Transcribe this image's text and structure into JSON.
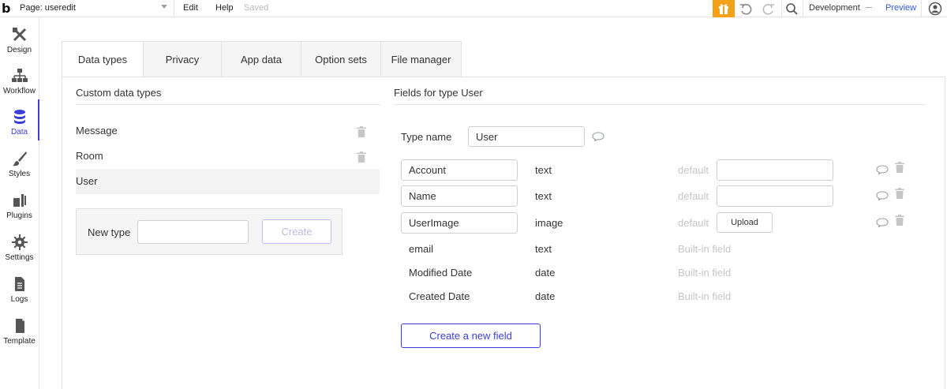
{
  "topbar": {
    "logo": "b",
    "page_label": "Page: useredit",
    "menu_edit": "Edit",
    "menu_help": "Help",
    "status": "Saved",
    "environment": "Development",
    "preview": "Preview",
    "icons": [
      "page-dropdown-icon",
      "gift-icon",
      "undo-icon",
      "redo-icon",
      "search-icon",
      "account-icon"
    ]
  },
  "sidebar": {
    "items": [
      {
        "label": "Design",
        "icon": "design-icon"
      },
      {
        "label": "Workflow",
        "icon": "workflow-icon"
      },
      {
        "label": "Data",
        "icon": "database-icon"
      },
      {
        "label": "Styles",
        "icon": "brush-icon"
      },
      {
        "label": "Plugins",
        "icon": "plugin-icon"
      },
      {
        "label": "Settings",
        "icon": "gear-icon"
      },
      {
        "label": "Logs",
        "icon": "logs-icon"
      },
      {
        "label": "Template",
        "icon": "template-icon"
      }
    ],
    "active": "Data"
  },
  "tabs": [
    {
      "label": "Data types"
    },
    {
      "label": "Privacy"
    },
    {
      "label": "App data"
    },
    {
      "label": "Option sets"
    },
    {
      "label": "File manager"
    }
  ],
  "custom_types": {
    "title": "Custom data types",
    "items": [
      {
        "name": "Message"
      },
      {
        "name": "Room"
      },
      {
        "name": "User"
      }
    ],
    "selected": "User",
    "new_type_label": "New type",
    "new_type_value": "",
    "create_button": "Create"
  },
  "fields": {
    "title": "Fields for type User",
    "type_name_label": "Type name",
    "type_name_value": "User",
    "custom": [
      {
        "name": "Account",
        "type": "text",
        "default_label": "default",
        "default_value": ""
      },
      {
        "name": "Name",
        "type": "text",
        "default_label": "default",
        "default_value": ""
      },
      {
        "name": "UserImage",
        "type": "image",
        "default_label": "default",
        "upload_label": "Upload"
      }
    ],
    "builtin": [
      {
        "name": "email",
        "type": "text",
        "note": "Built-in field"
      },
      {
        "name": "Modified Date",
        "type": "date",
        "note": "Built-in field"
      },
      {
        "name": "Created Date",
        "type": "date",
        "note": "Built-in field"
      }
    ],
    "new_field_button": "Create a new field"
  },
  "colors": {
    "accent": "#3b3fd8",
    "gift": "#f4a11a",
    "preview_link": "#2e5bd6",
    "muted_text": "#c5c5c5"
  }
}
